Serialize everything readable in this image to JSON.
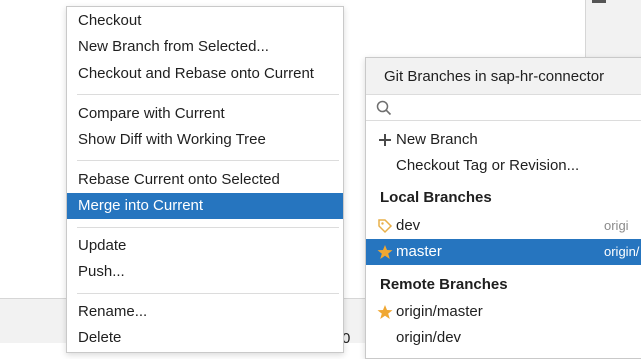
{
  "background": {
    "bottom_fragment": "0"
  },
  "context_menu": {
    "items": [
      {
        "label": "Checkout"
      },
      {
        "label": "New Branch from Selected..."
      },
      {
        "label": "Checkout and Rebase onto Current"
      },
      {
        "label": "Compare with Current"
      },
      {
        "label": "Show Diff with Working Tree"
      },
      {
        "label": "Rebase Current onto Selected"
      },
      {
        "label": "Merge into Current",
        "selected": true
      },
      {
        "label": "Update"
      },
      {
        "label": "Push..."
      },
      {
        "label": "Rename..."
      },
      {
        "label": "Delete"
      }
    ]
  },
  "branches_popup": {
    "title": "Git Branches in sap-hr-connector",
    "search": {
      "value": "",
      "placeholder": ""
    },
    "actions": [
      {
        "label": "New Branch",
        "icon": "plus-icon"
      },
      {
        "label": "Checkout Tag or Revision..."
      }
    ],
    "local_header": "Local Branches",
    "local": [
      {
        "name": "dev",
        "remote": "origi",
        "icon": "tag-icon"
      },
      {
        "name": "master",
        "remote": "origin/",
        "icon": "star-icon",
        "selected": true
      }
    ],
    "remote_header": "Remote Branches",
    "remote": [
      {
        "name": "origin/master",
        "icon": "star-icon"
      },
      {
        "name": "origin/dev"
      }
    ]
  },
  "colors": {
    "selection": "#2675bf",
    "star": "#f0a732",
    "tag": "#e8b04a"
  }
}
